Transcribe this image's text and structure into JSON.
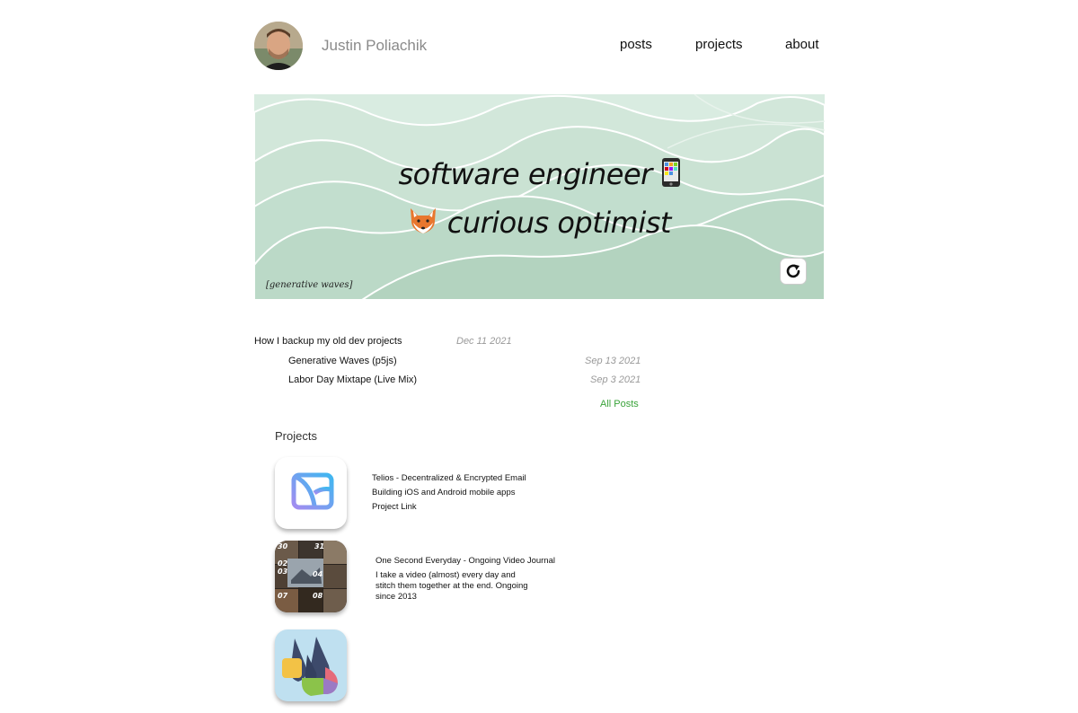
{
  "site": {
    "name": "Justin Poliachik"
  },
  "nav": {
    "posts": "posts",
    "projects": "projects",
    "about": "about"
  },
  "hero": {
    "line1": "software engineer",
    "line1_emoji": "mobile-phone",
    "line2_emoji": "fox",
    "line2": "curious optimist",
    "caption": "[generative waves]",
    "refresh_icon": "refresh-icon",
    "colors": {
      "background": "#d9ece1",
      "wave_fill": "#c2dece",
      "wave_stroke": "#ffffff"
    }
  },
  "posts": [
    {
      "title": "How I backup my old dev projects",
      "date": "Dec 11 2021"
    },
    {
      "title": "Generative Waves (p5js)",
      "date": "Sep 13 2021"
    },
    {
      "title": "Labor Day Mixtape (Live Mix)",
      "date": "Sep 3 2021"
    }
  ],
  "all_posts_label": "All Posts",
  "projects": {
    "title": "Projects",
    "items": [
      {
        "title": "Telios - Decentralized & Encrypted Email",
        "description": "Building iOS and Android mobile apps",
        "link": "Project Link"
      },
      {
        "title": "One Second Everyday - Ongoing Video Journal",
        "description": "I take a video (almost) every day and stitch them together at the end. Ongoing since 2013",
        "tile_labels": [
          "30",
          "31",
          "02",
          "03",
          "04",
          "07",
          "08"
        ]
      },
      {
        "title": "",
        "description": ""
      }
    ]
  },
  "colors": {
    "accent_link": "#3aa33a",
    "muted_text": "#999999"
  }
}
